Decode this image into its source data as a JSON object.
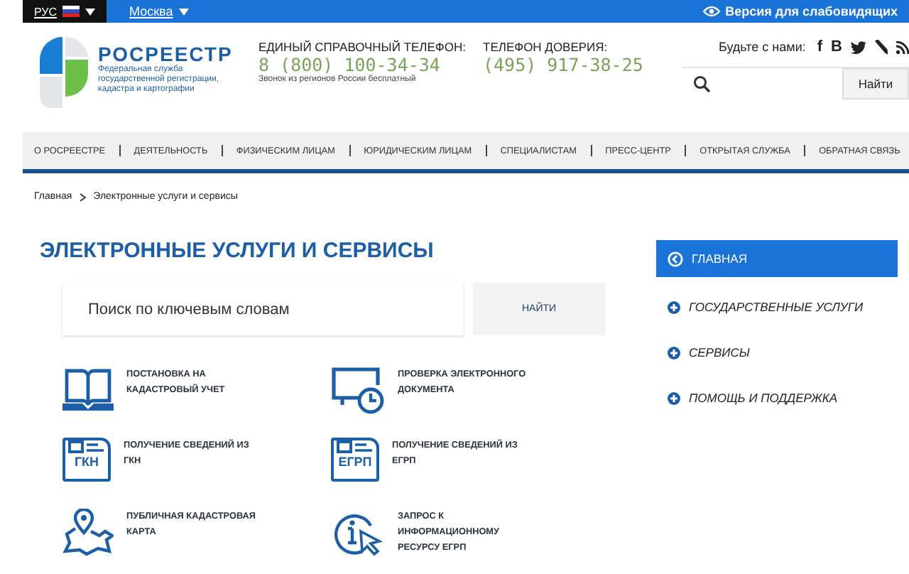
{
  "top_bar": {
    "language": "РУС",
    "region": "Москва",
    "accessibility_link": "Версия для слабовидящих"
  },
  "header": {
    "logo_title": "РОСРЕЕСТР",
    "logo_subtitle": "Федеральная служба государственной регистрации, кадастра и картографии",
    "hotline": {
      "label": "ЕДИНЫЙ СПРАВОЧНЫЙ ТЕЛЕФОН:",
      "number": "8 (800) 100-34-34",
      "note": "Звонок из регионов России бесплатный"
    },
    "trust_line": {
      "label": "ТЕЛЕФОН ДОВЕРИЯ:",
      "number": "(495) 917-38-25"
    },
    "social": {
      "label": "Будьте с нами:",
      "items": [
        {
          "kind": "glyph",
          "text": "f"
        },
        {
          "kind": "glyph",
          "text": "B"
        },
        {
          "kind": "bird"
        },
        {
          "kind": "pen"
        },
        {
          "kind": "rss"
        }
      ]
    },
    "search": {
      "button": "Найти"
    }
  },
  "nav": [
    "О РОСРЕЕСТРЕ",
    "ДЕЯТЕЛЬНОСТЬ",
    "ФИЗИЧЕСКИМ ЛИЦАМ",
    "ЮРИДИЧЕСКИМ ЛИЦАМ",
    "СПЕЦИАЛИСТАМ",
    "ПРЕСС-ЦЕНТР",
    "ОТКРЫТАЯ СЛУЖБА",
    "ОБРАТНАЯ СВЯЗЬ"
  ],
  "breadcrumb": [
    "Главная",
    "Электронные услуги и сервисы"
  ],
  "page_title": "ЭЛЕКТРОННЫЕ УСЛУГИ И СЕРВИСЫ",
  "search": {
    "placeholder": "Поиск по ключевым словам",
    "button": "НАЙТИ"
  },
  "services": [
    {
      "kind": "book",
      "label": "ПОСТАНОВКА НА КАДАСТРОВЫЙ УЧЕТ"
    },
    {
      "kind": "monitor",
      "label": "ПРОВЕРКА ЭЛЕКТРОННОГО ДОКУМЕНТА"
    },
    {
      "kind": "document",
      "badge": "ГКН",
      "label": "ПОЛУЧЕНИЕ СВЕДЕНИЙ ИЗ ГКН"
    },
    {
      "kind": "document",
      "badge": "ЕГРП",
      "label": "ПОЛУЧЕНИЕ СВЕДЕНИЙ ИЗ ЕГРП"
    },
    {
      "kind": "map",
      "label": "ПУБЛИЧНАЯ КАДАСТРОВАЯ КАРТА"
    },
    {
      "kind": "info",
      "label": "ЗАПРОС К ИНФОРМАЦИОННОМУ РЕСУРСУ ЕГРП"
    }
  ],
  "sidebar": [
    {
      "label": "ГЛАВНАЯ",
      "selected": true
    },
    {
      "label": "ГОСУДАРСТВЕННЫЕ УСЛУГИ",
      "selected": false
    },
    {
      "label": "СЕРВИСЫ",
      "selected": false
    },
    {
      "label": "ПОМОЩЬ И ПОДДЕРЖКА",
      "selected": false
    }
  ]
}
